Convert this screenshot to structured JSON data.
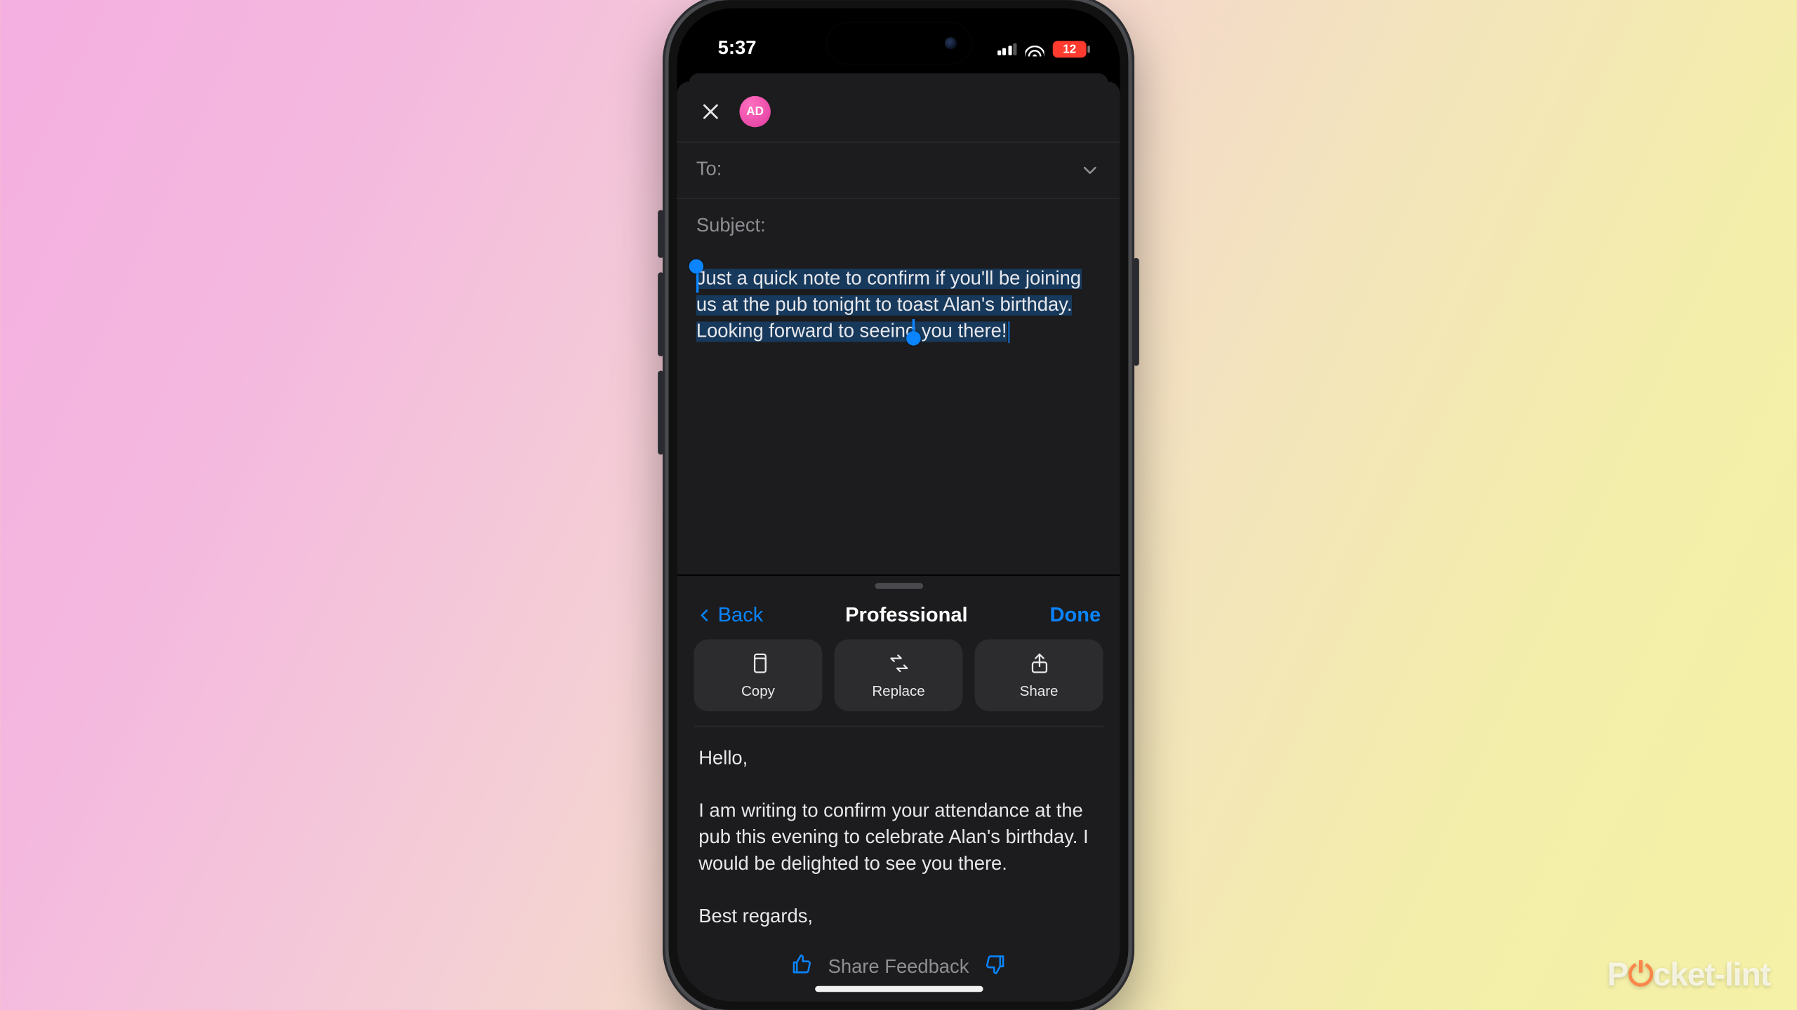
{
  "watermark": {
    "left": "P",
    "power": "⏻",
    "right": "cket-lint"
  },
  "status": {
    "time": "5:37",
    "battery": "12"
  },
  "compose": {
    "avatar_initials": "AD",
    "to_label": "To:",
    "subject_label": "Subject:",
    "body_selected": "Just a quick note to confirm if you'll be joining us at the pub tonight to toast Alan's birthday. Looking forward to seeing you there!"
  },
  "panel": {
    "back_label": "Back",
    "title": "Professional",
    "done_label": "Done",
    "actions": {
      "copy": "Copy",
      "replace": "Replace",
      "share": "Share"
    },
    "result_text": "Hello,\n\nI am writing to confirm your attendance at the pub this evening to celebrate Alan's birthday. I would be delighted to see you there.\n\nBest regards,",
    "feedback_label": "Share Feedback"
  }
}
